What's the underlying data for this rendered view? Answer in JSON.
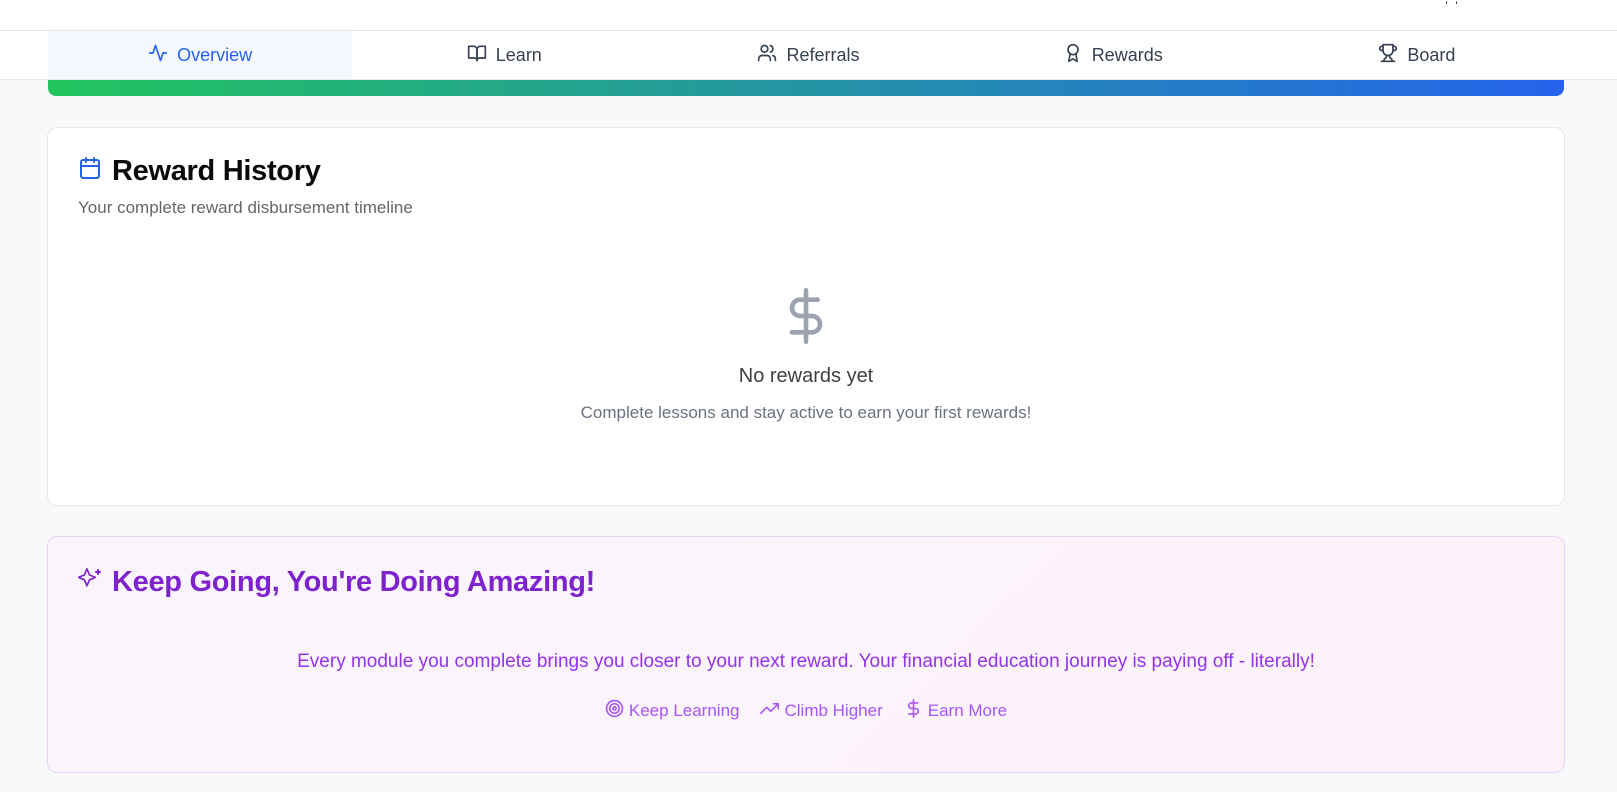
{
  "tabs": [
    {
      "label": "Overview",
      "icon": "activity-icon"
    },
    {
      "label": "Learn",
      "icon": "book-open-icon"
    },
    {
      "label": "Referrals",
      "icon": "users-icon"
    },
    {
      "label": "Rewards",
      "icon": "award-icon"
    },
    {
      "label": "Board",
      "icon": "trophy-icon"
    }
  ],
  "active_tab": "Overview",
  "reward_history": {
    "title": "Reward History",
    "subtitle": "Your complete reward disbursement timeline",
    "empty_title": "No rewards yet",
    "empty_subtitle": "Complete lessons and stay active to earn your first rewards!"
  },
  "promo": {
    "title": "Keep Going, You're Doing Amazing!",
    "text": "Every module you complete brings you closer to your next reward. Your financial education journey is paying off - literally!",
    "links": [
      {
        "label": "Keep Learning",
        "icon": "target-icon"
      },
      {
        "label": "Climb Higher",
        "icon": "trending-up-icon"
      },
      {
        "label": "Earn More",
        "icon": "dollar-sign-icon"
      }
    ]
  },
  "colors": {
    "accent": "#2563eb",
    "gradient_start": "#22c55e",
    "gradient_end": "#2563eb",
    "promo_purple": "#7e22ce"
  }
}
